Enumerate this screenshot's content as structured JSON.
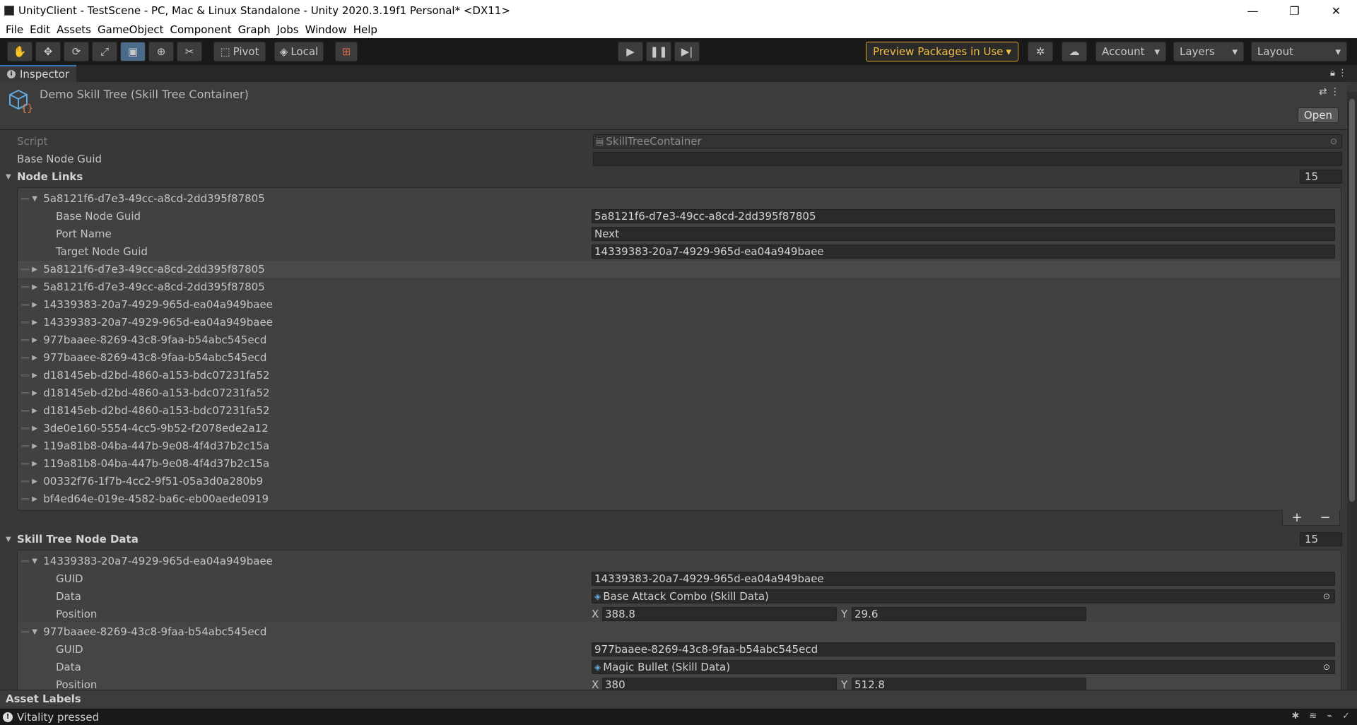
{
  "window": {
    "title": "UnityClient - TestScene - PC, Mac & Linux Standalone - Unity 2020.3.19f1 Personal* <DX11>"
  },
  "menu": [
    "File",
    "Edit",
    "Assets",
    "GameObject",
    "Component",
    "Graph",
    "Jobs",
    "Window",
    "Help"
  ],
  "toolbar": {
    "pivot": "Pivot",
    "local": "Local",
    "preview_packages": "Preview Packages in Use",
    "account": "Account",
    "layers": "Layers",
    "layout": "Layout"
  },
  "inspector": {
    "tab": "Inspector",
    "object_name": "Demo Skill Tree (Skill Tree Container)",
    "open_button": "Open",
    "script_label": "Script",
    "script_value": "SkillTreeContainer",
    "base_node_guid_label": "Base Node Guid",
    "base_node_guid_value": ""
  },
  "node_links": {
    "title": "Node Links",
    "count": "15",
    "expanded": {
      "header": "5a8121f6-d7e3-49cc-a8cd-2dd395f87805",
      "fields": [
        {
          "label": "Base Node Guid",
          "value": "5a8121f6-d7e3-49cc-a8cd-2dd395f87805"
        },
        {
          "label": "Port Name",
          "value": "Next"
        },
        {
          "label": "Target Node Guid",
          "value": "14339383-20a7-4929-965d-ea04a949baee"
        }
      ]
    },
    "items": [
      "5a8121f6-d7e3-49cc-a8cd-2dd395f87805",
      "5a8121f6-d7e3-49cc-a8cd-2dd395f87805",
      "14339383-20a7-4929-965d-ea04a949baee",
      "14339383-20a7-4929-965d-ea04a949baee",
      "977baaee-8269-43c8-9faa-b54abc545ecd",
      "977baaee-8269-43c8-9faa-b54abc545ecd",
      "d18145eb-d2bd-4860-a153-bdc07231fa52",
      "d18145eb-d2bd-4860-a153-bdc07231fa52",
      "d18145eb-d2bd-4860-a153-bdc07231fa52",
      "3de0e160-5554-4cc5-9b52-f2078ede2a12",
      "119a81b8-04ba-447b-9e08-4f4d37b2c15a",
      "119a81b8-04ba-447b-9e08-4f4d37b2c15a",
      "00332f76-1f7b-4cc2-9f51-05a3d0a280b9",
      "bf4ed64e-019e-4582-ba6c-eb00aede0919"
    ]
  },
  "skill_nodes": {
    "title": "Skill Tree Node Data",
    "count": "15",
    "nodes": [
      {
        "header": "14339383-20a7-4929-965d-ea04a949baee",
        "guid_label": "GUID",
        "guid": "14339383-20a7-4929-965d-ea04a949baee",
        "data_label": "Data",
        "data": "Base Attack Combo (Skill Data)",
        "pos_label": "Position",
        "x_label": "X",
        "x": "388.8",
        "y_label": "Y",
        "y": "29.6"
      },
      {
        "header": "977baaee-8269-43c8-9faa-b54abc545ecd",
        "guid_label": "GUID",
        "guid": "977baaee-8269-43c8-9faa-b54abc545ecd",
        "data_label": "Data",
        "data": "Magic Bullet (Skill Data)",
        "pos_label": "Position",
        "x_label": "X",
        "x": "380",
        "y_label": "Y",
        "y": "512.8"
      }
    ]
  },
  "asset_labels": "Asset Labels",
  "status": "Vitality pressed"
}
